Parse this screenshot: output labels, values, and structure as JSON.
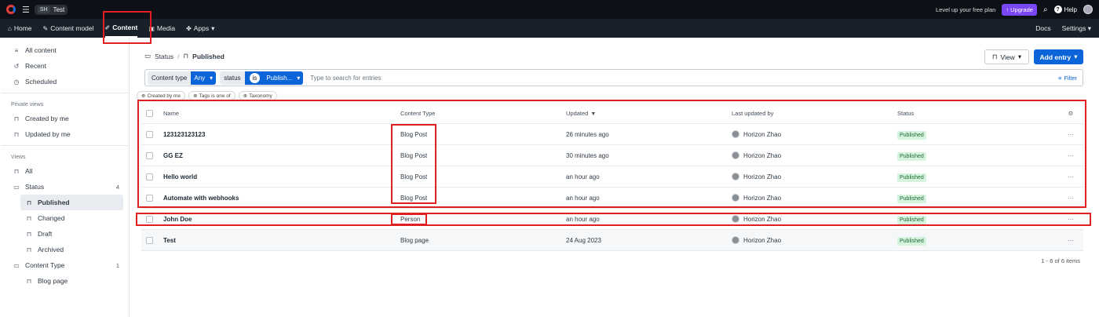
{
  "topbar": {
    "space_avatar": "SH",
    "space_name": "Test",
    "promo": "Level up your free plan",
    "upgrade_label": "Upgrade",
    "help_label": "Help"
  },
  "nav": {
    "items": [
      {
        "label": "Home",
        "icon": "home-icon"
      },
      {
        "label": "Content model",
        "icon": "wrench-icon"
      },
      {
        "label": "Content",
        "icon": "pen-icon",
        "active": true
      },
      {
        "label": "Media",
        "icon": "image-icon"
      },
      {
        "label": "Apps",
        "icon": "puzzle-icon"
      }
    ],
    "docs_label": "Docs",
    "settings_label": "Settings"
  },
  "sidebar": {
    "top_items": [
      "All content",
      "Recent",
      "Scheduled"
    ],
    "private_views_title": "Private views",
    "private_items": [
      "Created by me",
      "Updated by me"
    ],
    "views_title": "Views",
    "all_label": "All",
    "status_label": "Status",
    "status_count": "4",
    "status_children": [
      "Published",
      "Changed",
      "Draft",
      "Archived"
    ],
    "content_type_label": "Content Type",
    "content_type_count": "1",
    "content_type_children": [
      "Blog page"
    ]
  },
  "main": {
    "breadcrumb_parent": "Status",
    "breadcrumb_current": "Published",
    "view_label": "View",
    "add_entry_label": "Add entry",
    "filter_content_type_label": "Content type",
    "filter_content_type_value": "Any",
    "filter_status_label": "status",
    "filter_status_op": "is",
    "filter_status_value": "Publish...",
    "search_placeholder": "Type to search for entries",
    "filter_label": "Filter",
    "chips": [
      "Created by me",
      "Tags is one of",
      "Taxonomy"
    ],
    "columns": {
      "name": "Name",
      "content_type": "Content Type",
      "updated": "Updated",
      "last_updated_by": "Last updated by",
      "status": "Status"
    },
    "rows": [
      {
        "name": "123123123123",
        "type": "Blog Post",
        "updated": "26 minutes ago",
        "by": "Horizon Zhao",
        "status": "Published"
      },
      {
        "name": "GG EZ",
        "type": "Blog Post",
        "updated": "30 minutes ago",
        "by": "Horizon Zhao",
        "status": "Published"
      },
      {
        "name": "Hello world",
        "type": "Blog Post",
        "updated": "an hour ago",
        "by": "Horizon Zhao",
        "status": "Published"
      },
      {
        "name": "Automate with webhooks",
        "type": "Blog Post",
        "updated": "an hour ago",
        "by": "Horizon Zhao",
        "status": "Published"
      },
      {
        "name": "John Doe",
        "type": "Person",
        "updated": "an hour ago",
        "by": "Horizon Zhao",
        "status": "Published"
      },
      {
        "name": "Test",
        "type": "Blog page",
        "updated": "24 Aug 2023",
        "by": "Horizon Zhao",
        "status": "Published"
      }
    ],
    "pagination": "1 - 6 of 6 items"
  }
}
